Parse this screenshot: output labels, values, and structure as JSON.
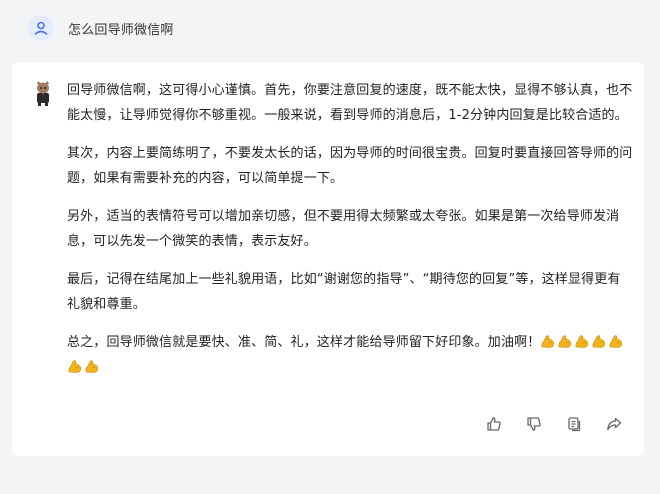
{
  "user": {
    "question": "怎么回导师微信啊"
  },
  "answer": {
    "paragraphs": [
      "回导师微信啊，这可得小心谨慎。首先，你要注意回复的速度，既不能太快，显得不够认真，也不能太慢，让导师觉得你不够重视。一般来说，看到导师的消息后，1-2分钟内回复是比较合适的。",
      "其次，内容上要简练明了，不要发太长的话，因为导师的时间很宝贵。回复时要直接回答导师的问题，如果有需要补充的内容，可以简单提一下。",
      "另外，适当的表情符号可以增加亲切感，但不要用得太频繁或太夸张。如果是第一次给导师发消息，可以先发一个微笑的表情，表示友好。",
      "最后，记得在结尾加上一些礼貌用语，比如“谢谢您的指导”、“期待您的回复”等，这样显得更有礼貌和尊重。"
    ],
    "final": "总之，回导师微信就是要快、准、简、礼，这样才能给导师留下好印象。加油啊！",
    "emoji": "flexed-biceps-emoji",
    "emoji_count": 7
  },
  "actions": [
    "thumbs-up-icon",
    "thumbs-down-icon",
    "copy-icon",
    "share-icon"
  ],
  "colors": {
    "background": "#f3f4f6",
    "card": "#ffffff",
    "text": "#222222",
    "user_avatar_bg": "#e6ecff",
    "user_avatar_fg": "#4f6ef7",
    "emoji": "#f2b41c",
    "icon": "#666666"
  }
}
